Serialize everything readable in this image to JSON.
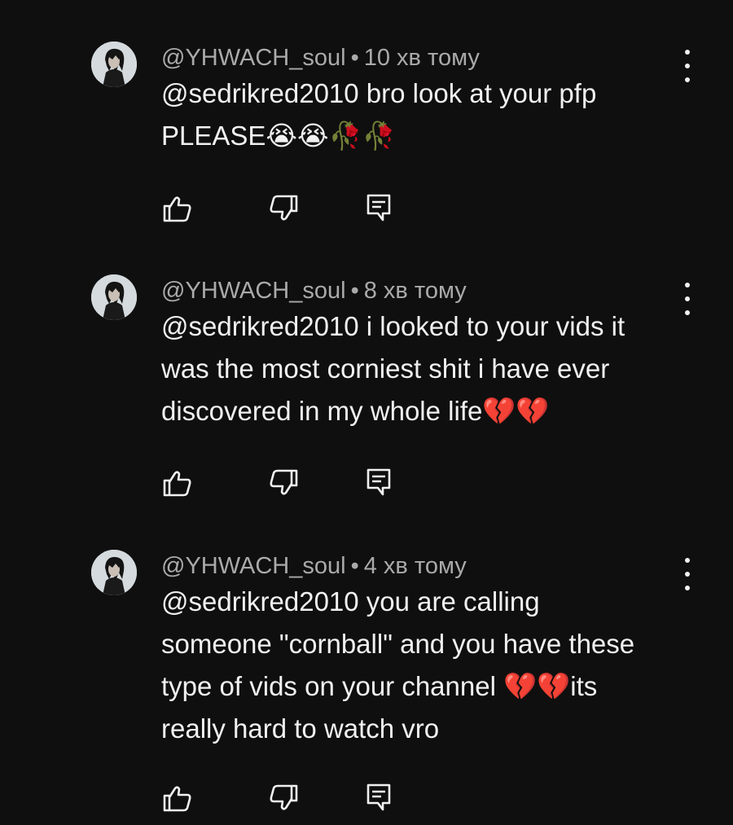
{
  "comments": [
    {
      "author": "@YHWACH_soul",
      "separator": "•",
      "time": "10 хв тому",
      "text": "@sedrikred2010 bro look at your pfp\nPLEASE😭😭🥀🥀"
    },
    {
      "author": "@YHWACH_soul",
      "separator": "•",
      "time": "8 хв тому",
      "text": "@sedrikred2010 i looked to your vids it\nwas the most corniest shit i have ever\ndiscovered in my whole life💔💔"
    },
    {
      "author": "@YHWACH_soul",
      "separator": "•",
      "time": "4 хв тому",
      "text": "@sedrikred2010 you are calling\nsomeone \"cornball\" and you have these\ntype of vids on your channel 💔💔its\nreally hard to watch vro"
    }
  ],
  "icons": {
    "like": "thumbs-up-icon",
    "dislike": "thumbs-down-icon",
    "reply": "reply-icon",
    "more": "more-vertical-icon"
  },
  "colors": {
    "background": "#0f0f0f",
    "text": "#f1f1f1",
    "meta": "#aaaaaa"
  }
}
